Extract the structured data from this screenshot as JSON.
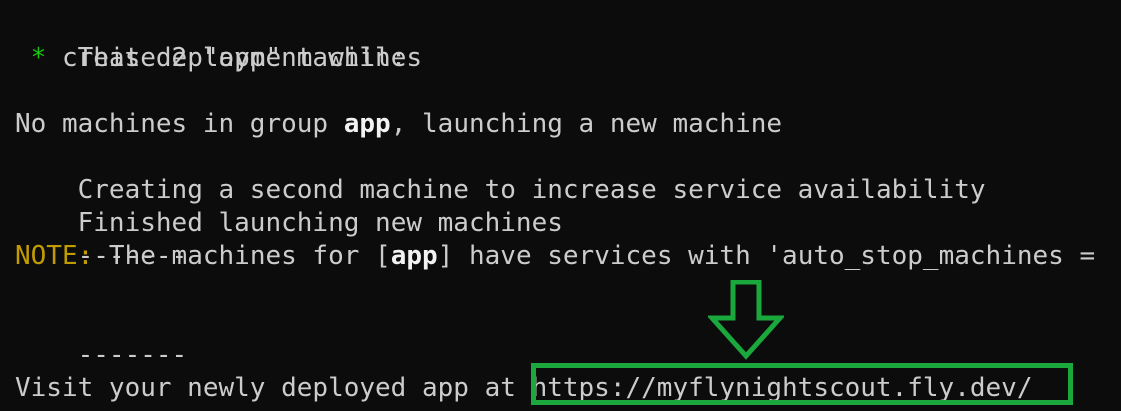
{
  "colors": {
    "background": "#0c0c0c",
    "text": "#cccccc",
    "bold_text": "#f2f2f2",
    "bullet": "#16c60c",
    "note": "#c19c00",
    "annotation": "#1aa83c"
  },
  "lines": {
    "deployment_header": "This deployment will:",
    "bullet_prefix": " * ",
    "create_item": "create 2 \"app\" machines",
    "no_machines_prefix": "No machines in group ",
    "group_name": "app",
    "no_machines_suffix": ", launching a new machine",
    "second_machine": "Creating a second machine to increase service availability",
    "finished": "Finished launching new machines",
    "separator_1": "-------",
    "note_label": "NOTE:",
    "note_text_1": " The machines for [",
    "note_group": "app",
    "note_text_2": "] have services with 'auto_stop_machines = ",
    "separator_2": "-------",
    "visit_prefix": "Visit your newly deployed app at ",
    "app_url": "https://myflynightscout.fly.dev/"
  },
  "icons": {
    "arrow": "down-arrow-icon",
    "bullet": "asterisk-bullet"
  }
}
